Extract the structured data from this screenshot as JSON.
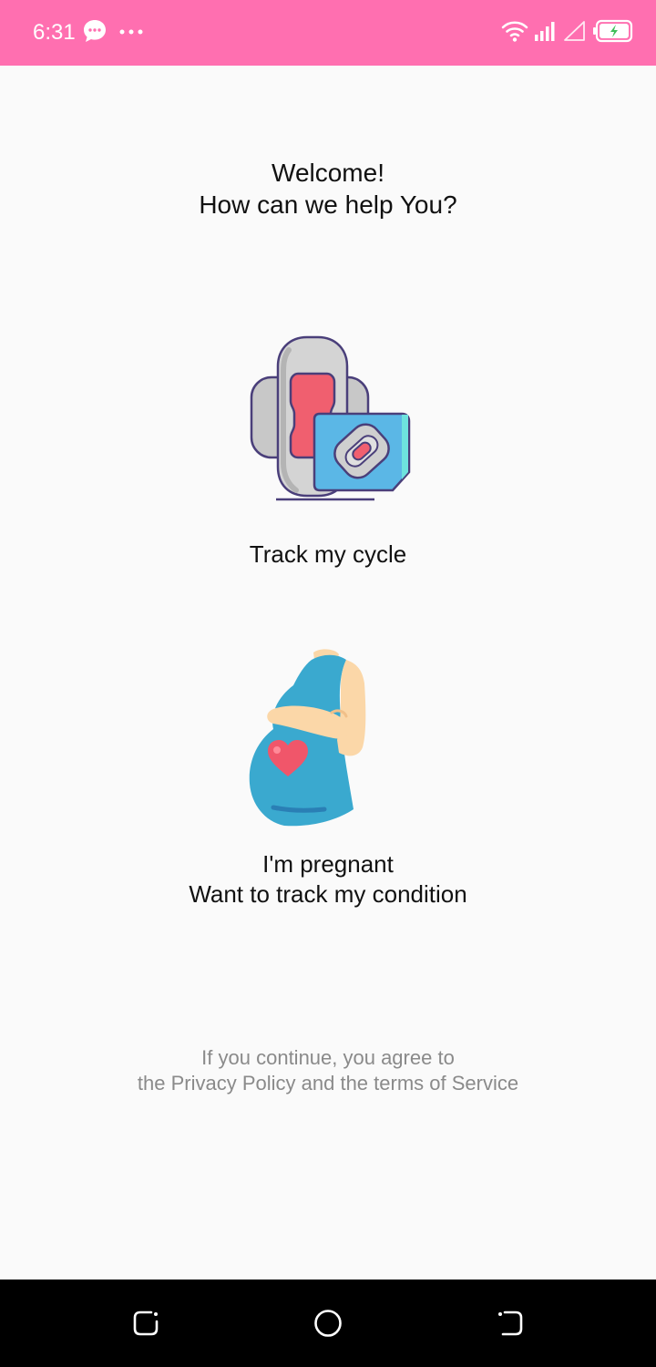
{
  "status_bar": {
    "time": "6:31",
    "background_color": "#ff6fb0",
    "left_icons": [
      "message-icon",
      "more-dots-icon"
    ],
    "right_icons": [
      "wifi-icon",
      "signal-icon",
      "no-sim-signal-icon",
      "battery-charging-icon"
    ]
  },
  "welcome": {
    "line1": "Welcome!",
    "line2": "How can we help You?"
  },
  "options": {
    "cycle": {
      "icon": "sanitary-pad-icon",
      "label": "Track my cycle"
    },
    "pregnant": {
      "icon": "pregnant-woman-icon",
      "label_line1": "I'm pregnant",
      "label_line2": "Want to track my condition"
    }
  },
  "terms": {
    "line1": "If you continue, you agree to",
    "line2": "the Privacy Policy and the terms of Service"
  },
  "nav_bar": {
    "buttons": [
      "recent-apps-icon",
      "home-icon",
      "back-icon"
    ]
  }
}
